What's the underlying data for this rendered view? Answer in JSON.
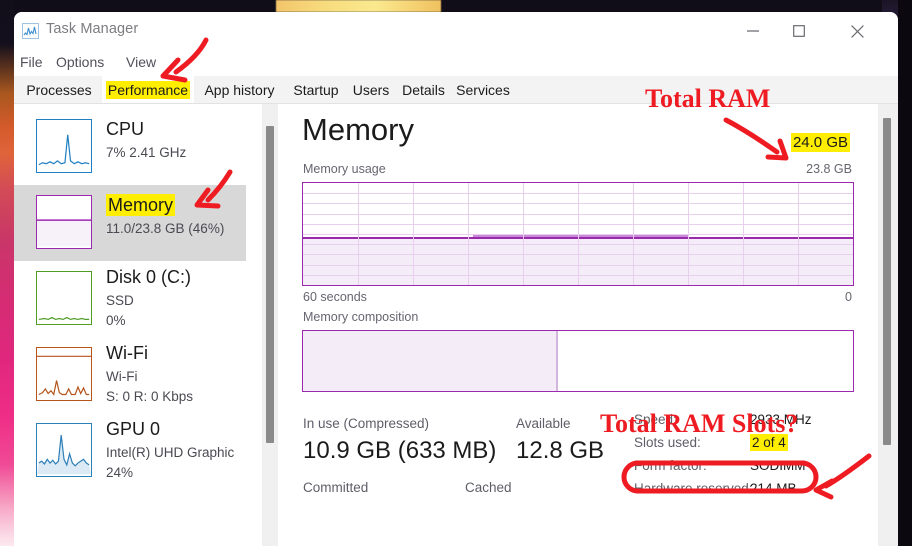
{
  "window": {
    "title": "Task Manager",
    "icon": "task-manager-icon",
    "controls": {
      "minimize": "—",
      "maximize": "□",
      "close": "✕"
    }
  },
  "menubar": {
    "items": [
      "File",
      "Options",
      "View"
    ]
  },
  "tabs": [
    {
      "label": "Processes",
      "active": false,
      "highlighted": false
    },
    {
      "label": "Performance",
      "active": true,
      "highlighted": true
    },
    {
      "label": "App history",
      "active": false,
      "highlighted": false
    },
    {
      "label": "Startup",
      "active": false,
      "highlighted": false
    },
    {
      "label": "Users",
      "active": false,
      "highlighted": false
    },
    {
      "label": "Details",
      "active": false,
      "highlighted": false
    },
    {
      "label": "Services",
      "active": false,
      "highlighted": false
    }
  ],
  "sidebar": {
    "items": [
      {
        "name": "CPU",
        "line1": "7% 2.41 GHz",
        "line2": "",
        "color": "#1f7fc0",
        "selected": false,
        "highlighted": false
      },
      {
        "name": "Memory",
        "line1": "11.0/23.8 GB (46%)",
        "line2": "",
        "color": "#9b29ae",
        "selected": true,
        "highlighted": true
      },
      {
        "name": "Disk 0 (C:)",
        "line1": "SSD",
        "line2": "0%",
        "color": "#4f9c27",
        "selected": false,
        "highlighted": false
      },
      {
        "name": "Wi-Fi",
        "line1": "Wi-Fi",
        "line2": "S: 0 R: 0 Kbps",
        "color": "#b5551b",
        "selected": false,
        "highlighted": false
      },
      {
        "name": "GPU 0",
        "line1": "Intel(R) UHD Graphic",
        "line2": "24%",
        "color": "#2d7fb8",
        "selected": false,
        "highlighted": false
      }
    ]
  },
  "main": {
    "heading": "Memory",
    "total_ram": "24.0 GB",
    "usage_caption": "Memory usage",
    "usage_max": "23.8 GB",
    "time_label": "60 seconds",
    "time_zero": "0",
    "composition_caption": "Memory composition",
    "stats": [
      {
        "label": "In use (Compressed)",
        "value": "10.9 GB (633 MB)"
      },
      {
        "label": "Available",
        "value": "12.8 GB"
      },
      {
        "label": "Committed",
        "value": ""
      },
      {
        "label": "Cached",
        "value": ""
      }
    ],
    "info": [
      {
        "label": "Speed:",
        "value": "2933 MHz",
        "highlighted": false
      },
      {
        "label": "Slots used:",
        "value": "2 of 4",
        "highlighted": true
      },
      {
        "label": "Form factor:",
        "value": "SODIMM",
        "highlighted": false
      },
      {
        "label": "Hardware reserved:",
        "value": "214 MB",
        "highlighted": false
      }
    ]
  },
  "annotations": {
    "total_ram": "Total RAM",
    "total_ram_slots": "Total RAM Slots?",
    "color": "#ee1c22",
    "highlight_color": "#ffee00"
  },
  "chart_data": {
    "type": "area",
    "title": "Memory usage",
    "xlabel": "60 seconds",
    "ylabel": "GB",
    "ylim": [
      0,
      23.8
    ],
    "xlim": [
      60,
      0
    ],
    "grid": true,
    "grid_columns": 10,
    "grid_rows": 10,
    "series": [
      {
        "name": "Memory in use",
        "fill_percent": 46,
        "values": [
          10.9,
          10.9,
          10.9,
          10.9,
          10.9,
          10.9,
          10.9,
          10.9,
          10.9,
          10.9,
          10.9,
          10.9,
          11.0,
          11.1,
          11.1,
          11.0,
          11.0,
          11.1,
          11.0,
          10.9,
          10.9,
          10.9,
          11.0,
          11.0,
          10.9,
          10.9,
          10.9,
          10.9,
          10.9,
          10.9
        ]
      }
    ],
    "composition": {
      "type": "bar",
      "segments": [
        {
          "name": "In use",
          "percent": 46
        },
        {
          "name": "Available",
          "percent": 54
        }
      ]
    }
  }
}
